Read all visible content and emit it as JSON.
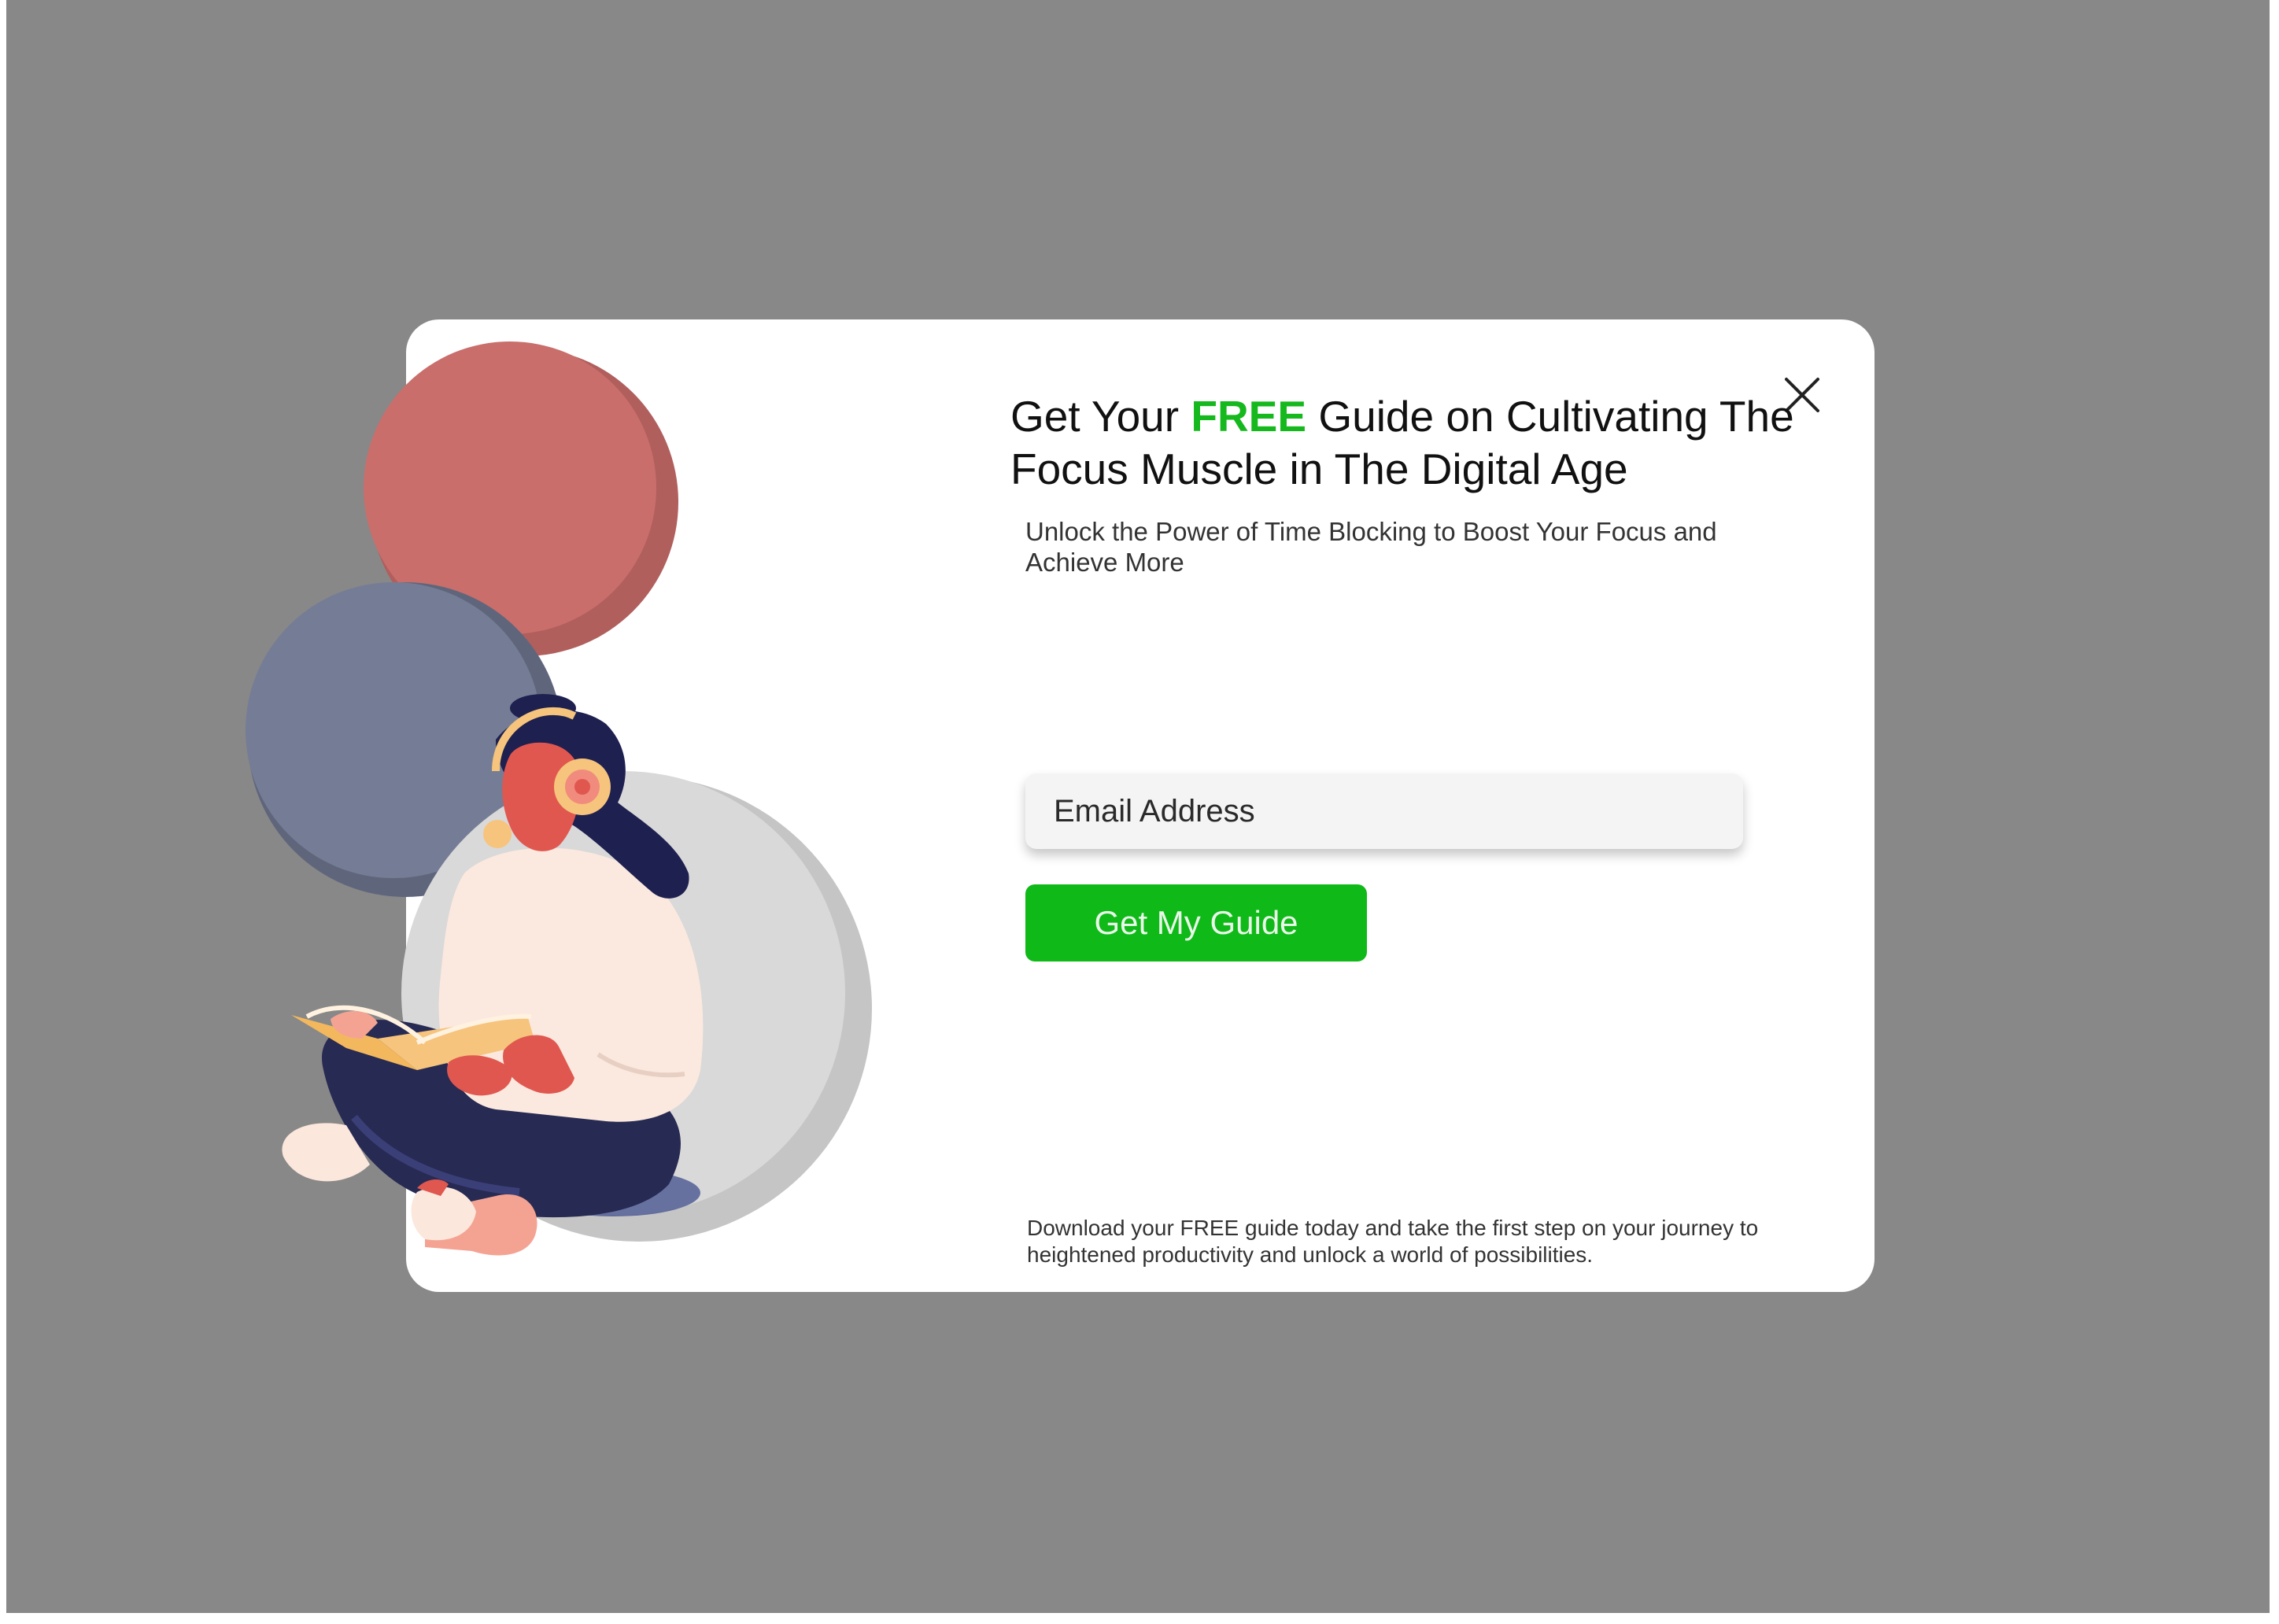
{
  "popup": {
    "headline_prefix": "Get Your ",
    "headline_highlight": "FREE",
    "headline_suffix": " Guide on Cultivating The Focus Muscle in The Digital Age",
    "subtitle": "Unlock the Power of Time Blocking to Boost Your Focus and Achieve More",
    "email_placeholder": "Email Address",
    "cta_label": "Get My Guide",
    "footer": "Download your FREE guide today and take the first step on your journey to heightened productivity and unlock a world of possibilities.",
    "close_icon": "close-icon",
    "illustration": "woman-reading-book-with-headphones"
  },
  "colors": {
    "backdrop": "#888888",
    "modal_bg": "#ffffff",
    "accent_green": "#15b81d",
    "button_green": "#0fb918",
    "circle_red": "#c96e6b",
    "circle_slate": "#757d96",
    "circle_gray": "#d9d9d9"
  }
}
